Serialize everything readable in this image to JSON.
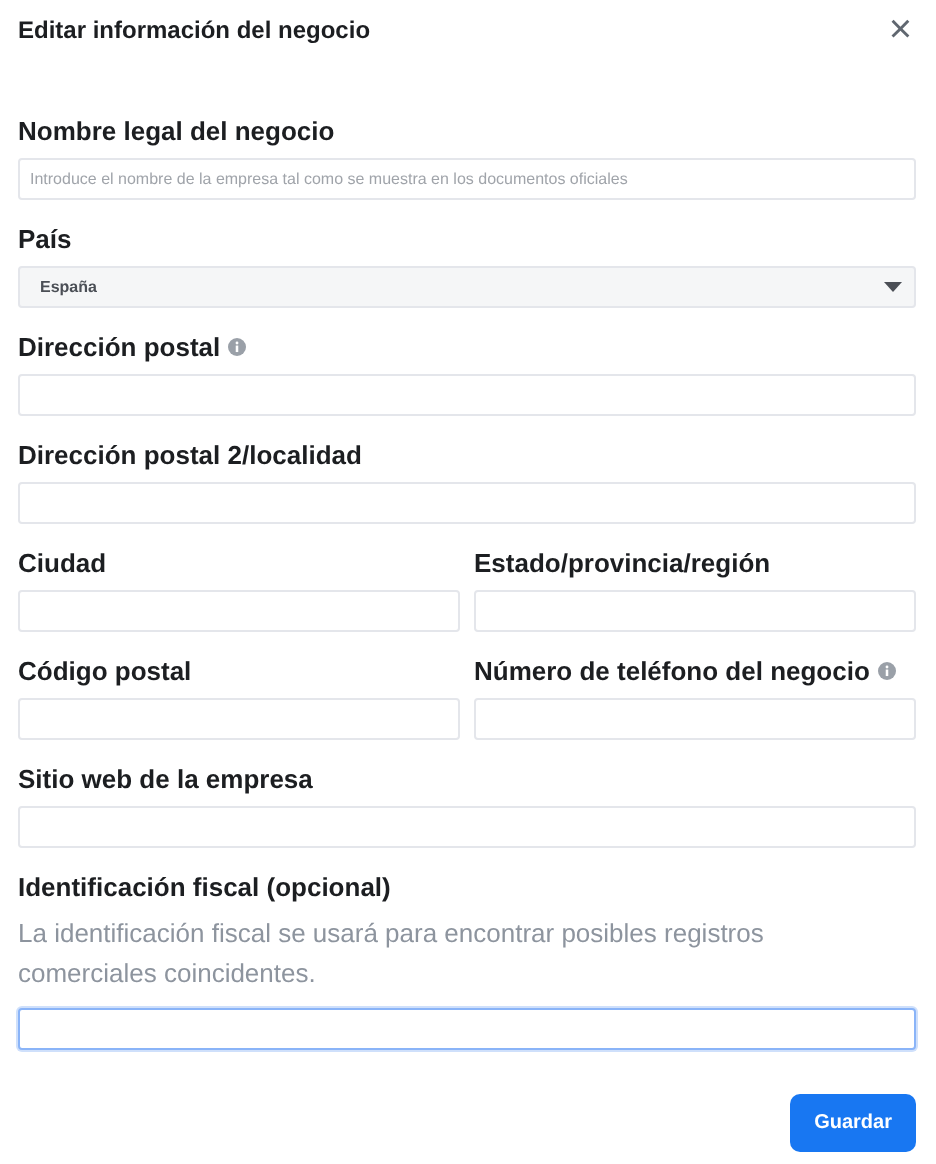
{
  "dialog": {
    "title": "Editar información del negocio",
    "close": "×"
  },
  "rows": [
    {
      "fields": [
        {
          "kind": "text",
          "label": "Nombre legal del negocio",
          "placeholder": "Introduce el nombre de la empresa tal como se muestra en los documentos oficiales"
        }
      ]
    },
    {
      "fields": [
        {
          "kind": "select",
          "label": "País",
          "value": "España"
        }
      ]
    },
    {
      "fields": [
        {
          "kind": "text",
          "label": "Dirección postal",
          "info": true
        }
      ]
    },
    {
      "fields": [
        {
          "kind": "text",
          "label": "Dirección postal 2/localidad"
        }
      ]
    },
    {
      "fields": [
        {
          "kind": "text",
          "label": "Ciudad"
        },
        {
          "kind": "text",
          "label": "Estado/provincia/región"
        }
      ]
    },
    {
      "fields": [
        {
          "kind": "text",
          "label": "Código postal"
        },
        {
          "kind": "text",
          "label": "Número de teléfono del negocio",
          "info": true
        }
      ]
    },
    {
      "fields": [
        {
          "kind": "text",
          "label": "Sitio web de la empresa"
        }
      ]
    },
    {
      "fields": [
        {
          "kind": "text",
          "label": "Identificación fiscal (opcional)",
          "description": "La identificación fiscal se usará para encontrar posibles registros comerciales coincidentes.",
          "focused": true
        }
      ]
    }
  ],
  "buttons": [
    {
      "label": "Guardar"
    }
  ]
}
